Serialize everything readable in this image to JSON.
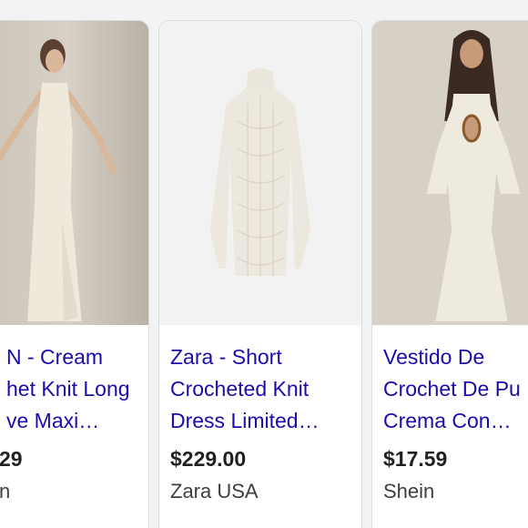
{
  "results": [
    {
      "title_lines": [
        "N - Cream",
        "het Knit Long",
        "ve Maxi…"
      ],
      "price": "29",
      "seller": "n",
      "image": "woman-cream-knit-maxi-dress-photo"
    },
    {
      "title_lines": [
        "Zara - Short",
        "Crocheted Knit",
        "Dress Limited…"
      ],
      "price": "$229.00",
      "seller": "Zara USA",
      "image": "white-crochet-dress-product-photo"
    },
    {
      "title_lines": [
        "Vestido De",
        "Crochet De Pu",
        "Crema Con…"
      ],
      "price": "$17.59",
      "seller": "Shein",
      "image": "woman-crochet-bell-sleeve-dress-photo"
    }
  ],
  "colors": {
    "link": "#1a0dab",
    "price": "#202124",
    "background": "#f1f3f4"
  }
}
